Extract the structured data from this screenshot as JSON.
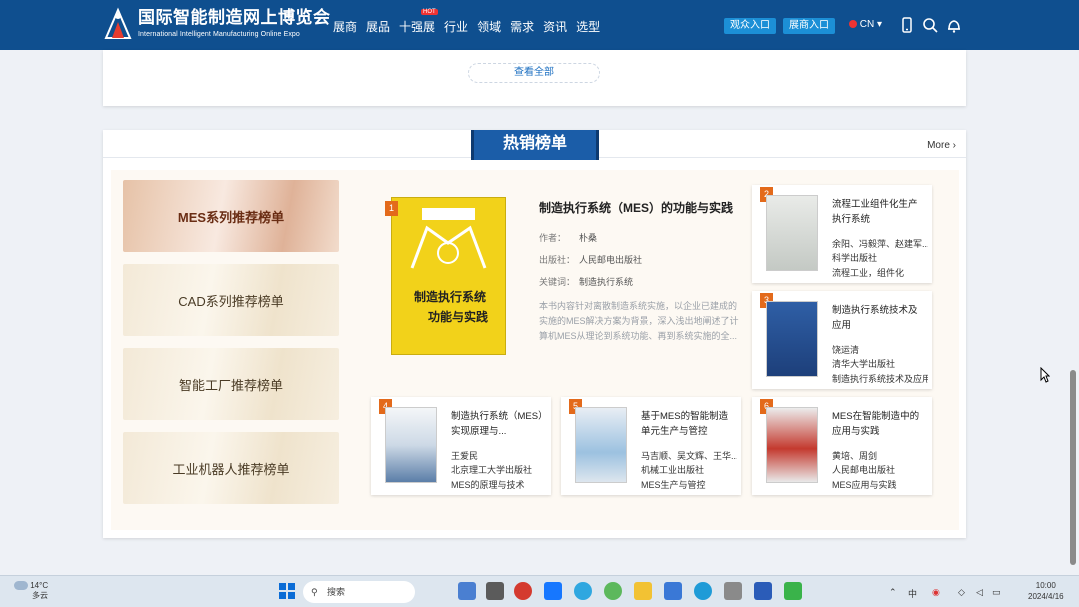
{
  "header": {
    "logo_cn": "国际智能制造网上博览会",
    "logo_en": "International Intelligent Manufacturing Online Expo",
    "nav": [
      "展商",
      "展品",
      "十强展",
      "行业",
      "领域",
      "需求",
      "资讯",
      "选型"
    ],
    "hot_tag": "HOT",
    "btn_viewer": "观众入口",
    "btn_exhibitor": "展商入口",
    "lang": "CN"
  },
  "top_card": {
    "view_all": "查看全部"
  },
  "section": {
    "title": "热销榜单",
    "more": "More ›",
    "categories": [
      {
        "label": "MES系列推荐榜单",
        "active": true
      },
      {
        "label": "CAD系列推荐榜单",
        "active": false
      },
      {
        "label": "智能工厂推荐榜单",
        "active": false
      },
      {
        "label": "工业机器人推荐榜单",
        "active": false
      }
    ],
    "featured": {
      "rank": "1",
      "cover_line1": "制造执行系统",
      "cover_line2": "功能与实践",
      "title": "制造执行系统（MES）的功能与实践",
      "author_label": "作者：",
      "author": "朴桑",
      "publisher_label": "出版社：",
      "publisher": "人民邮电出版社",
      "keyword_label": "关键词：",
      "keyword": "制造执行系统",
      "desc": "本书内容针对离散制造系统实施，以企业已建成的实施的MES解决方案为背景，深入浅出地阐述了计算机MES从理论到系统功能、再到系统实施的全..."
    },
    "books": [
      {
        "rank": "2",
        "title": "流程工业组件化生产执行系统",
        "line1": "余阳、冯毅萍、赵建军...",
        "line2": "科学出版社",
        "line3": "流程工业，组件化"
      },
      {
        "rank": "3",
        "title": "制造执行系统技术及应用",
        "line1": "饶运清",
        "line2": "清华大学出版社",
        "line3": "制造执行系统技术及应用"
      },
      {
        "rank": "4",
        "title": "制造执行系统（MES）实现原理与...",
        "line1": "王爱民",
        "line2": "北京理工大学出版社",
        "line3": "MES的原理与技术"
      },
      {
        "rank": "5",
        "title": "基于MES的智能制造单元生产与管控",
        "line1": "马吉顺、吴文辉、王华...",
        "line2": "机械工业出版社",
        "line3": "MES生产与管控"
      },
      {
        "rank": "6",
        "title": "MES在智能制造中的应用与实践",
        "line1": "黄培、周剑",
        "line2": "人民邮电出版社",
        "line3": "MES应用与实践"
      }
    ]
  },
  "taskbar": {
    "weather_temp": "14°C",
    "weather_desc": "多云",
    "search": "搜索",
    "lang": "中",
    "time": "10:00",
    "date": "2024/4/16"
  }
}
